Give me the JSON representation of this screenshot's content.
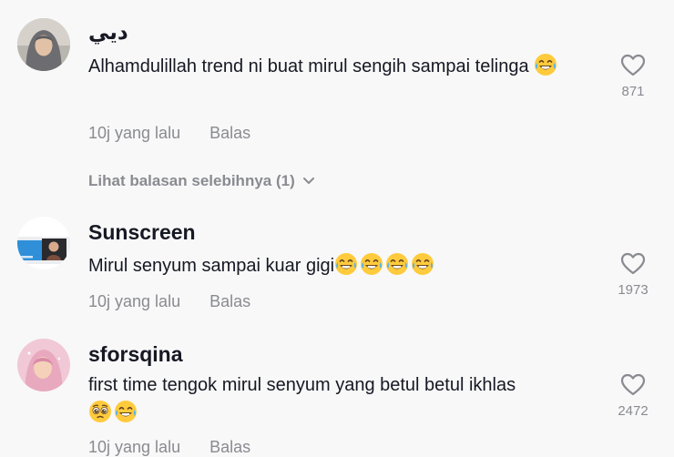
{
  "comments": [
    {
      "username": "ديي",
      "text": "Alhamdulillah trend ni buat mirul sengih sampai telinga",
      "emojis": [
        "tears-of-joy"
      ],
      "time": "10j yang lalu",
      "reply_label": "Balas",
      "likes": "871"
    },
    {
      "username": "Sunscreen",
      "text": "Mirul senyum sampai kuar gigi",
      "emojis": [
        "tears-of-joy",
        "tears-of-joy",
        "tears-of-joy",
        "tears-of-joy"
      ],
      "time": "10j yang lalu",
      "reply_label": "Balas",
      "likes": "1973"
    },
    {
      "username": "sforsqina",
      "text": "first time tengok mirul senyum yang betul betul ikhlas",
      "emojis": [
        "pleading-face",
        "tears-of-joy"
      ],
      "time": "10j yang lalu",
      "reply_label": "Balas",
      "likes": "2472"
    }
  ],
  "view_more_replies": "Lihat balasan selebihnya (1)",
  "colors": {
    "background": "#f8f8f8",
    "text": "#161823",
    "muted": "#8a8b91"
  }
}
